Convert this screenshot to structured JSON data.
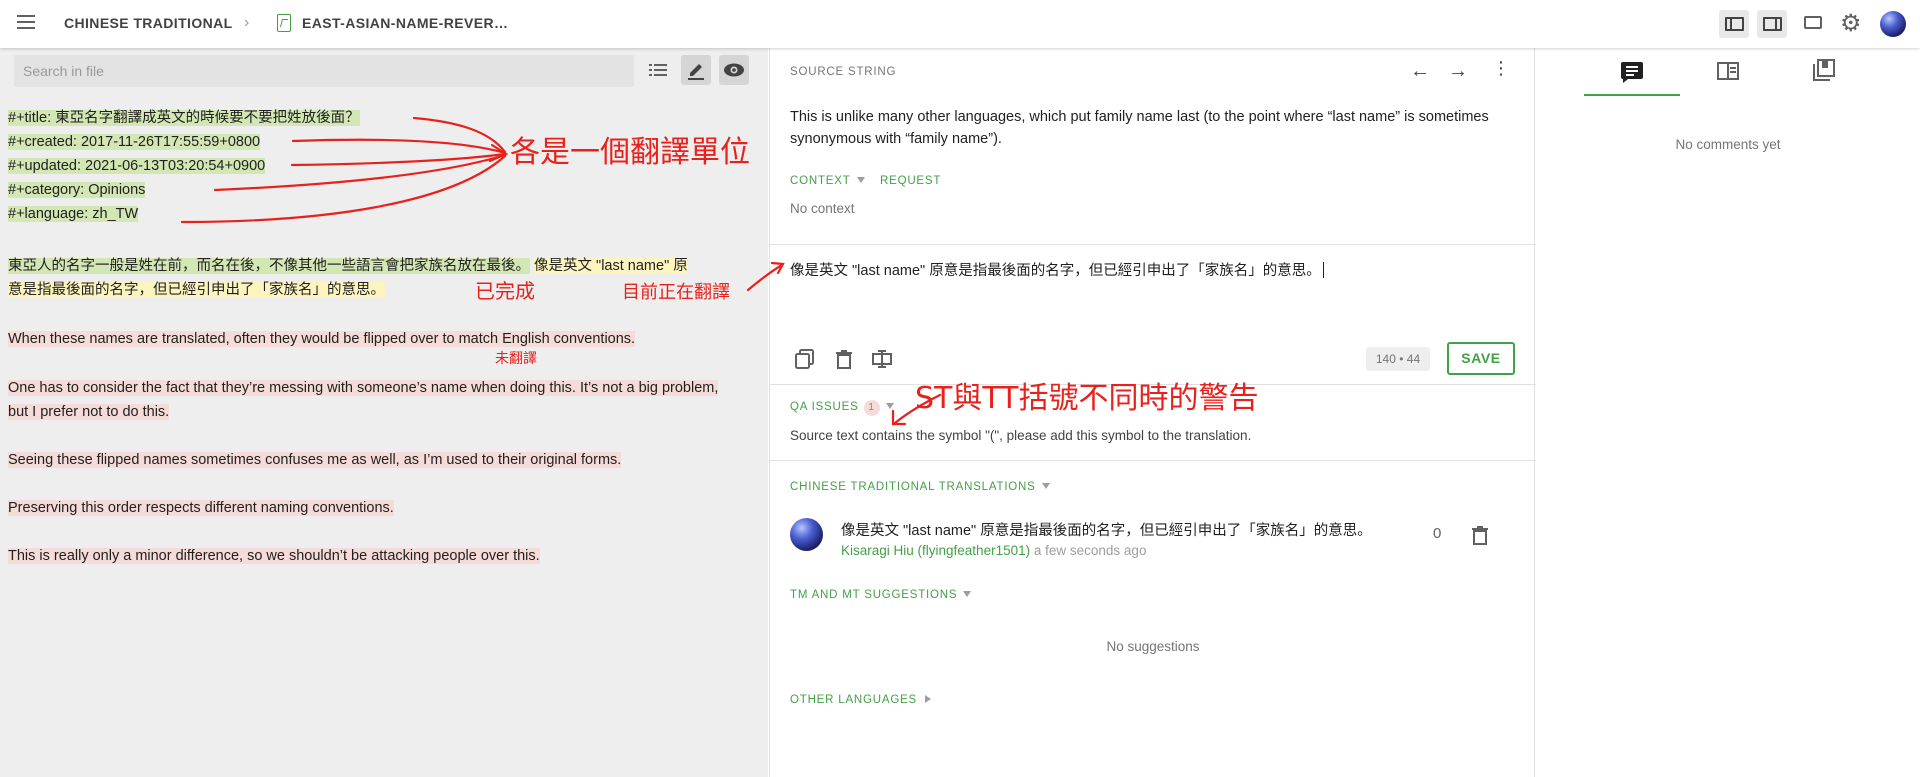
{
  "header": {
    "project": "CHINESE TRADITIONAL",
    "file": "EAST-ASIAN-NAME-REVER…"
  },
  "left": {
    "search_placeholder": "Search in file",
    "meta_lines": [
      "#+title: 東亞名字翻譯成英文的時候要不要把姓放後面？",
      "#+created: 2017-11-26T17:55:59+0800",
      "#+updated: 2021-06-13T03:20:54+0900",
      "#+category: Opinions",
      "#+language: zh_TW"
    ],
    "para1_done": "東亞人的名字一般是姓在前，而名在後，不像其他一些語言會把家族名放在最後。",
    "para1_current_a": "像是英文 \"last name\" 原",
    "para1_current_b": "意是指最後面的名字，但已經引申出了「家族名」的意思。",
    "para2": "When these names are translated, often they would be flipped over to match English conventions.",
    "para3_a": "One has to consider the fact that they’re messing with someone’s name when doing this.",
    "para3_b": " It’s not a big problem,",
    "para3_c": "but I prefer not to do this.",
    "para4": "Seeing these flipped names sometimes confuses me as well, as I’m used to their original forms.",
    "para5": "Preserving this order respects different naming conventions.",
    "para6": "This is really only a minor difference, so we shouldn’t be attacking people over this."
  },
  "middle": {
    "source_label": "SOURCE STRING",
    "source_text": "This is unlike many other languages, which put family name last (to the point where “last name” is sometimes synonymous with “family name”).",
    "context_label": "CONTEXT",
    "request_label": "REQUEST",
    "no_context": "No context",
    "translation": "像是英文 \"last name\" 原意是指最後面的名字，但已經引申出了「家族名」的意思。",
    "counter": "140 • 44",
    "save_label": "SAVE",
    "qa_label": "QA ISSUES",
    "qa_count": "1",
    "qa_message": "Source text contains the symbol \"(\", please add this symbol to the translation.",
    "translations_label": "CHINESE TRADITIONAL TRANSLATIONS",
    "suggestion_text": "像是英文 \"last name\" 原意是指最後面的名字，但已經引申出了「家族名」的意思。",
    "suggestion_votes": "0",
    "suggestion_author": "Kisaragi Hiu (flyingfeather1501)",
    "suggestion_time": "a few seconds ago",
    "tm_label": "TM AND MT SUGGESTIONS",
    "no_suggestions": "No suggestions",
    "other_languages_label": "OTHER LANGUAGES"
  },
  "right": {
    "no_comments": "No comments yet"
  },
  "annotations": {
    "units": "各是一個翻譯單位",
    "done": "已完成",
    "translating": "目前正在翻譯",
    "untranslated": "未翻譯",
    "qa_note": "ST與TT括號不同時的警告"
  },
  "colors": {
    "accent": "#43a047",
    "annotation": "#e8211d",
    "translated_highlight": "#d3e7b4",
    "current_highlight": "#fbf4bf",
    "untranslated_highlight": "#f6dcd8"
  }
}
